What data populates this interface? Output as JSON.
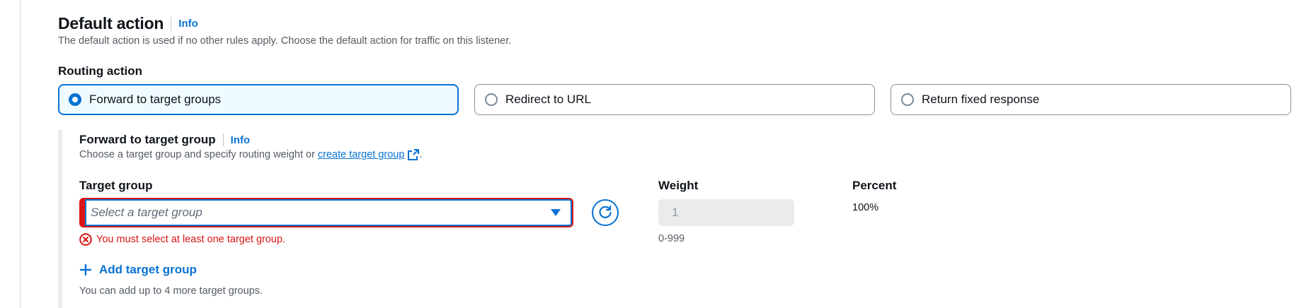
{
  "default_action": {
    "title": "Default action",
    "info": "Info",
    "description": "The default action is used if no other rules apply. Choose the default action for traffic on this listener."
  },
  "routing": {
    "label": "Routing action",
    "options": [
      {
        "label": "Forward to target groups",
        "selected": true
      },
      {
        "label": "Redirect to URL",
        "selected": false
      },
      {
        "label": "Return fixed response",
        "selected": false
      }
    ]
  },
  "forward": {
    "title": "Forward to target group",
    "info": "Info",
    "description_prefix": "Choose a target group and specify routing weight or",
    "create_link": "create target group",
    "description_suffix": "."
  },
  "target_group": {
    "label": "Target group",
    "placeholder": "Select a target group",
    "error": "You must select at least one target group."
  },
  "weight": {
    "label": "Weight",
    "value": "1",
    "hint": "0-999"
  },
  "percent": {
    "label": "Percent",
    "value": "100%"
  },
  "add": {
    "label": "Add target group",
    "hint": "You can add up to 4 more target groups."
  },
  "colors": {
    "accent": "#0972d3",
    "error": "#d91515",
    "muted": "#545b64"
  },
  "icons": {
    "external": "external-link-icon",
    "refresh": "refresh-icon",
    "error": "error-icon",
    "add": "plus-icon"
  }
}
